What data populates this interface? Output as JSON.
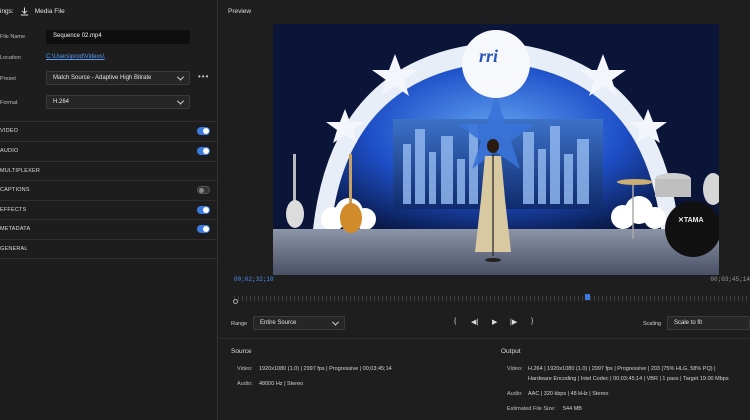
{
  "settings": {
    "prefix": "ings:",
    "media_file_label": "Media File",
    "file_name_label": "File Name",
    "file_name_value": "Sequence 02.mp4",
    "location_label": "Location",
    "location_value": "C:\\Users\\prod\\Videos\\",
    "preset_label": "Preset",
    "preset_value": "Match Source - Adaptive High Bitrate",
    "more_label": "•••",
    "format_label": "Format",
    "format_value": "H.264"
  },
  "sections": [
    {
      "label": "VIDEO",
      "on": true
    },
    {
      "label": "AUDIO",
      "on": true
    },
    {
      "label": "MULTIPLEXER",
      "on": null
    },
    {
      "label": "CAPTIONS",
      "on": false
    },
    {
      "label": "EFFECTS",
      "on": true
    },
    {
      "label": "METADATA",
      "on": true
    },
    {
      "label": "GENERAL",
      "on": null
    }
  ],
  "preview": {
    "title": "Preview",
    "timecode_current": "00;02;32;10",
    "timecode_end": "00;03;45;14",
    "playhead_fraction": 0.68,
    "video_logo": "rri",
    "range_label": "Range",
    "range_value": "Entire Source",
    "scaling_label": "Scaling",
    "scaling_value": "Scale to fit",
    "transport": {
      "in": "{",
      "prev": "◀|",
      "play": "▶",
      "next": "|▶",
      "out": "}"
    }
  },
  "source": {
    "title": "Source",
    "video_label": "Video:",
    "video_value": "1920x1080 (1.0)  |  2997 fps  |  Progressive  |  00;03;45;14",
    "audio_label": "Audio:",
    "audio_value": "48000 Hz  |  Stereo"
  },
  "output": {
    "title": "Output",
    "video_label": "Video:",
    "video_line1": "H.264  |  1920x1080 (1.0)  |  2997 fps  |  Progressive  |  203 (75% HLG, 58% PQ)  |",
    "video_line2": "Hardware Encoding  |  Intel Codec  |  00;03;45;14  |  VBR  |  1 pass  |  Target 19.00 Mbps",
    "audio_label": "Audio:",
    "audio_value": "AAC  |  320 kbps  |  48 kHz  |  Stereo",
    "size_label": "Estimated File Size:",
    "size_value": "544 MB"
  },
  "colors": {
    "accent": "#3b7be0",
    "link": "#5b9cf5"
  }
}
